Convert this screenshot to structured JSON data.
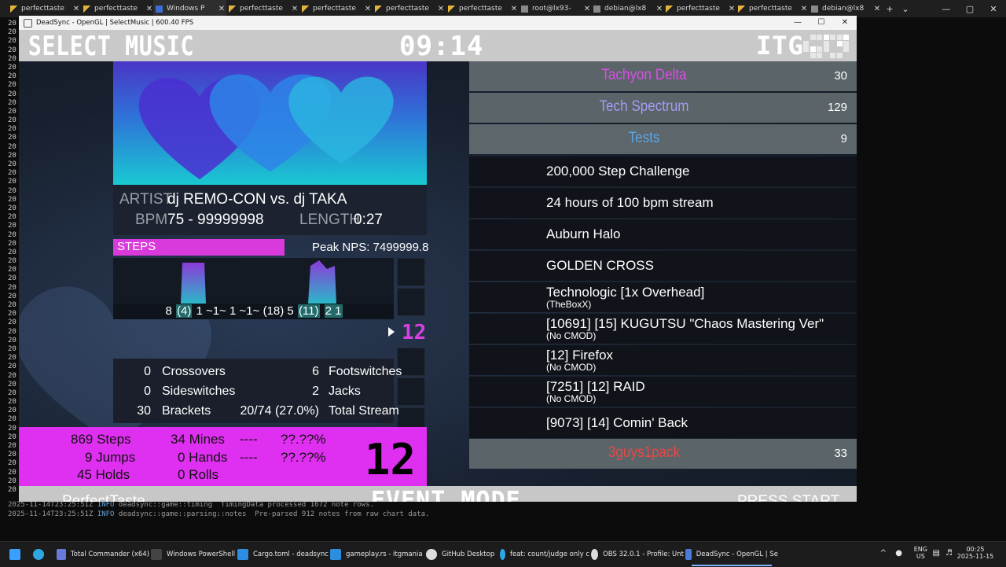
{
  "browser_tabs": [
    {
      "label": "perfecttaste",
      "icon": "triangle-icon"
    },
    {
      "label": "perfecttaste",
      "icon": "triangle-icon"
    },
    {
      "label": "Windows P",
      "icon": "terminal-icon",
      "active": true
    },
    {
      "label": "perfecttaste",
      "icon": "triangle-icon"
    },
    {
      "label": "perfecttaste",
      "icon": "triangle-icon"
    },
    {
      "label": "perfecttaste",
      "icon": "triangle-icon"
    },
    {
      "label": "perfecttaste",
      "icon": "triangle-icon"
    },
    {
      "label": "root@lx93-",
      "icon": "penguin-icon"
    },
    {
      "label": "debian@lx8",
      "icon": "penguin-icon"
    },
    {
      "label": "perfecttaste",
      "icon": "triangle-icon"
    },
    {
      "label": "perfecttaste",
      "icon": "triangle-icon"
    },
    {
      "label": "debian@lx8",
      "icon": "penguin-icon"
    }
  ],
  "terminal": {
    "gutter_value": "20",
    "log_lines": [
      {
        "ts": "2025-11-14T23:25:51Z",
        "level": "INFO",
        "msg": " deadsync::game::timing  TimingData processed 1672 note rows."
      },
      {
        "ts": "2025-11-14T23:25:51Z",
        "level": "INFO",
        "msg": " deadsync::game::parsing::notes  Pre-parsed 912 notes from raw chart data."
      }
    ]
  },
  "window": {
    "title": "DeadSync - OpenGL | SelectMusic | 600.40 FPS",
    "minimize": "—",
    "maximize": "☐",
    "close": "✕"
  },
  "header": {
    "title": "SELECT MUSIC",
    "timer": "09:14",
    "logo": "ITG"
  },
  "song_info": {
    "artist_label": "ARTIST",
    "artist": "dj REMO-CON vs. dj TAKA",
    "bpm_label": "BPM",
    "bpm": "75 - 99999998",
    "length_label": "LENGTH",
    "length": "0:27"
  },
  "steps": {
    "label": "STEPS",
    "peak_nps": "Peak NPS: 7499999.8",
    "breakdown_parts": [
      "8 ",
      "(4)",
      " 1 ~1~ 1 ~1~ (18) 5 ",
      "(11)",
      " ",
      "2 1"
    ]
  },
  "difficulty_side": "12",
  "stats": {
    "crossovers": {
      "value": "0",
      "label": "Crossovers"
    },
    "sideswitches": {
      "value": "0",
      "label": "Sideswitches"
    },
    "brackets": {
      "value": "30",
      "label": "Brackets"
    },
    "footswitches": {
      "value": "6",
      "label": "Footswitches"
    },
    "jacks": {
      "value": "2",
      "label": "Jacks"
    },
    "total_stream": {
      "value": "20/74 (27.0%)",
      "label": "Total Stream"
    }
  },
  "pane": {
    "steps": "869 Steps",
    "mines": "34 Mines",
    "dash1": "----",
    "pct1": "??.??%",
    "jumps": "9 Jumps",
    "hands": "0 Hands",
    "dash2": "----",
    "pct2": "??.??%",
    "holds": "45 Holds",
    "rolls": "0 Rolls",
    "meter": "12"
  },
  "wheel": [
    {
      "type": "group",
      "name": "Tachyon Delta",
      "count": "30",
      "color": "#d94fe8"
    },
    {
      "type": "group",
      "name": "Tech Spectrum",
      "count": "129",
      "color": "#a39cf2"
    },
    {
      "type": "group",
      "name": "Tests",
      "count": "9",
      "color": "#5aa5e8",
      "selected": true
    },
    {
      "type": "song",
      "title": "200,000 Step Challenge",
      "sub": ""
    },
    {
      "type": "song",
      "title": "24 hours of 100 bpm stream",
      "sub": ""
    },
    {
      "type": "song",
      "title": "Auburn Halo",
      "sub": ""
    },
    {
      "type": "song",
      "title": "GOLDEN CROSS",
      "sub": ""
    },
    {
      "type": "song",
      "title": "Technologic [1x Overhead]",
      "sub": "(TheBoxX)"
    },
    {
      "type": "song",
      "title": "[10691] [15] KUGUTSU \"Chaos Mastering Ver\"",
      "sub": "(No CMOD)"
    },
    {
      "type": "song",
      "title": "[12] Firefox",
      "sub": "(No CMOD)"
    },
    {
      "type": "song",
      "title": "[7251] [12] RAID",
      "sub": "(No CMOD)"
    },
    {
      "type": "song",
      "title": "[9073] [14] Comin' Back",
      "sub": ""
    },
    {
      "type": "group",
      "name": "3guys1pack",
      "count": "33",
      "color": "#e84848"
    }
  ],
  "footer": {
    "player": "PerfectTaste",
    "mode": "EVENT MODE",
    "prompt": "PRESS START"
  },
  "taskbar": {
    "items": [
      {
        "label": "",
        "icon": "windows-start-icon"
      },
      {
        "label": "",
        "icon": "edge-icon"
      },
      {
        "label": "Total Commander (x64)",
        "icon": "floppy-icon"
      },
      {
        "label": "Windows PowerShell",
        "icon": "terminal-icon"
      },
      {
        "label": "Cargo.toml - deadsync",
        "icon": "vscode-icon"
      },
      {
        "label": "gameplay.rs - itgmania",
        "icon": "vscode-icon"
      },
      {
        "label": "GitHub Desktop",
        "icon": "github-icon"
      },
      {
        "label": "feat: count/judge only c",
        "icon": "edge-icon"
      },
      {
        "label": "OBS 32.0.1 - Profile: Unt",
        "icon": "obs-icon"
      },
      {
        "label": "DeadSync - OpenGL | Se",
        "icon": "app-icon",
        "active": true
      }
    ],
    "lang": "ENG",
    "region": "US",
    "time": "00:25",
    "date": "2025-11-15"
  }
}
